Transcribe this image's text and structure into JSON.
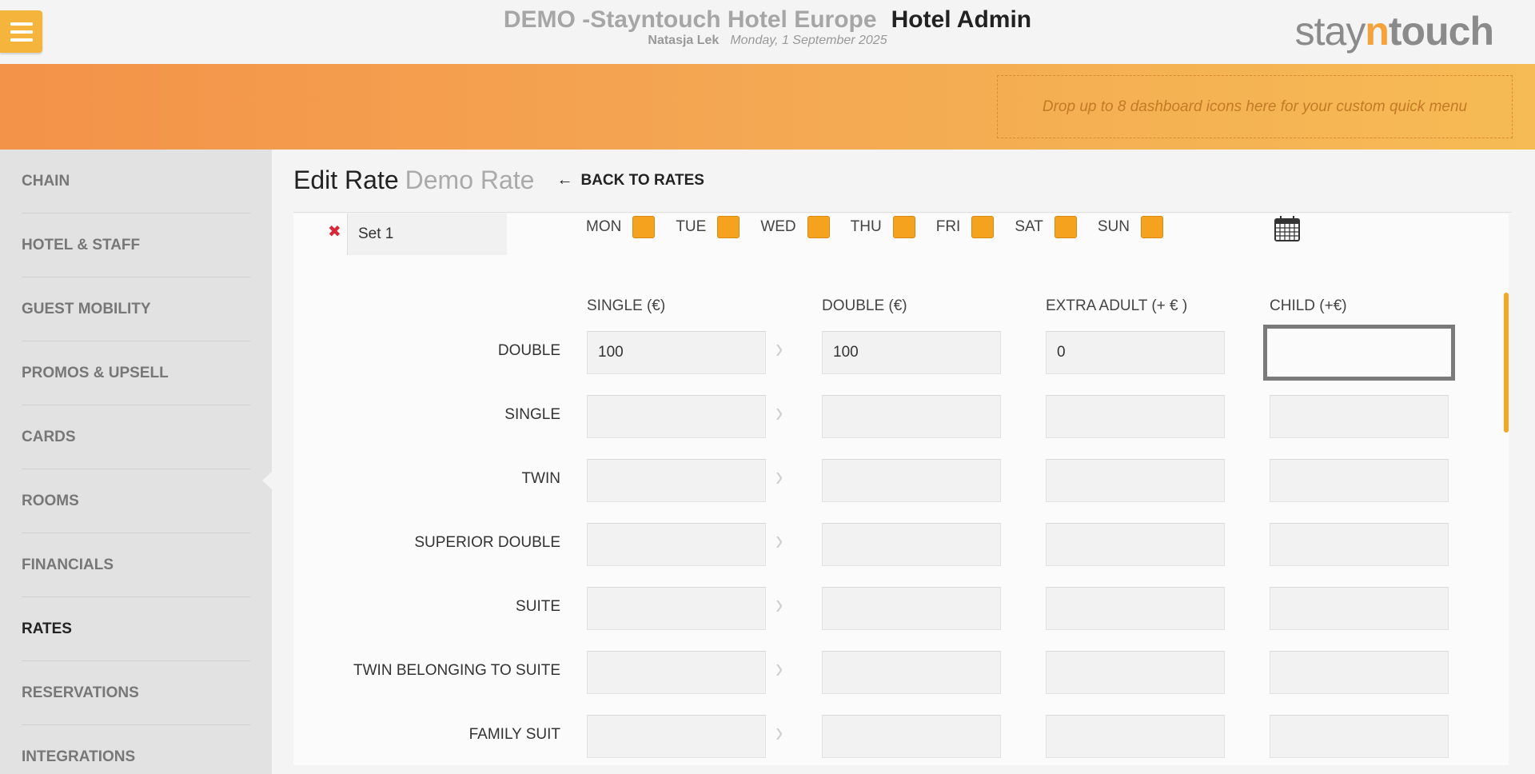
{
  "header": {
    "hotel_name": "DEMO -Stayntouch Hotel Europe",
    "app_name": "Hotel Admin",
    "user": "Natasja Lek",
    "date": "Monday, 1 September 2025",
    "logo_part1": "stay",
    "logo_part2": "n",
    "logo_part3": "touch"
  },
  "banner": {
    "dropzone_text": "Drop up to 8 dashboard icons here for your custom quick menu"
  },
  "sidebar": {
    "items": [
      {
        "label": "CHAIN"
      },
      {
        "label": "HOTEL & STAFF"
      },
      {
        "label": "GUEST MOBILITY"
      },
      {
        "label": "PROMOS & UPSELL"
      },
      {
        "label": "CARDS"
      },
      {
        "label": "ROOMS"
      },
      {
        "label": "FINANCIALS"
      },
      {
        "label": "RATES"
      },
      {
        "label": "RESERVATIONS"
      },
      {
        "label": "INTEGRATIONS"
      }
    ],
    "active": "RATES"
  },
  "page": {
    "title": "Edit Rate",
    "subtitle": "Demo Rate",
    "back_label": "BACK TO RATES"
  },
  "set": {
    "remove_glyph": "✖",
    "name": "Set 1"
  },
  "days": [
    "MON",
    "TUE",
    "WED",
    "THU",
    "FRI",
    "SAT",
    "SUN"
  ],
  "columns": [
    "SINGLE (€)",
    "DOUBLE (€)",
    "EXTRA ADULT (+ € )",
    "CHILD (+€)"
  ],
  "rows": [
    {
      "label": "DOUBLE",
      "values": [
        "100",
        "100",
        "0",
        ""
      ]
    },
    {
      "label": "SINGLE",
      "values": [
        "",
        "",
        "",
        ""
      ]
    },
    {
      "label": "TWIN",
      "values": [
        "",
        "",
        "",
        ""
      ]
    },
    {
      "label": "SUPERIOR DOUBLE",
      "values": [
        "",
        "",
        "",
        ""
      ]
    },
    {
      "label": "SUITE",
      "values": [
        "",
        "",
        "",
        ""
      ]
    },
    {
      "label": "TWIN BELONGING TO SUITE",
      "values": [
        "",
        "",
        "",
        ""
      ]
    },
    {
      "label": "FAMILY SUIT",
      "values": [
        "",
        "",
        "",
        ""
      ]
    }
  ],
  "colors": {
    "accent": "#f5a21e",
    "remove": "#d9263a"
  }
}
